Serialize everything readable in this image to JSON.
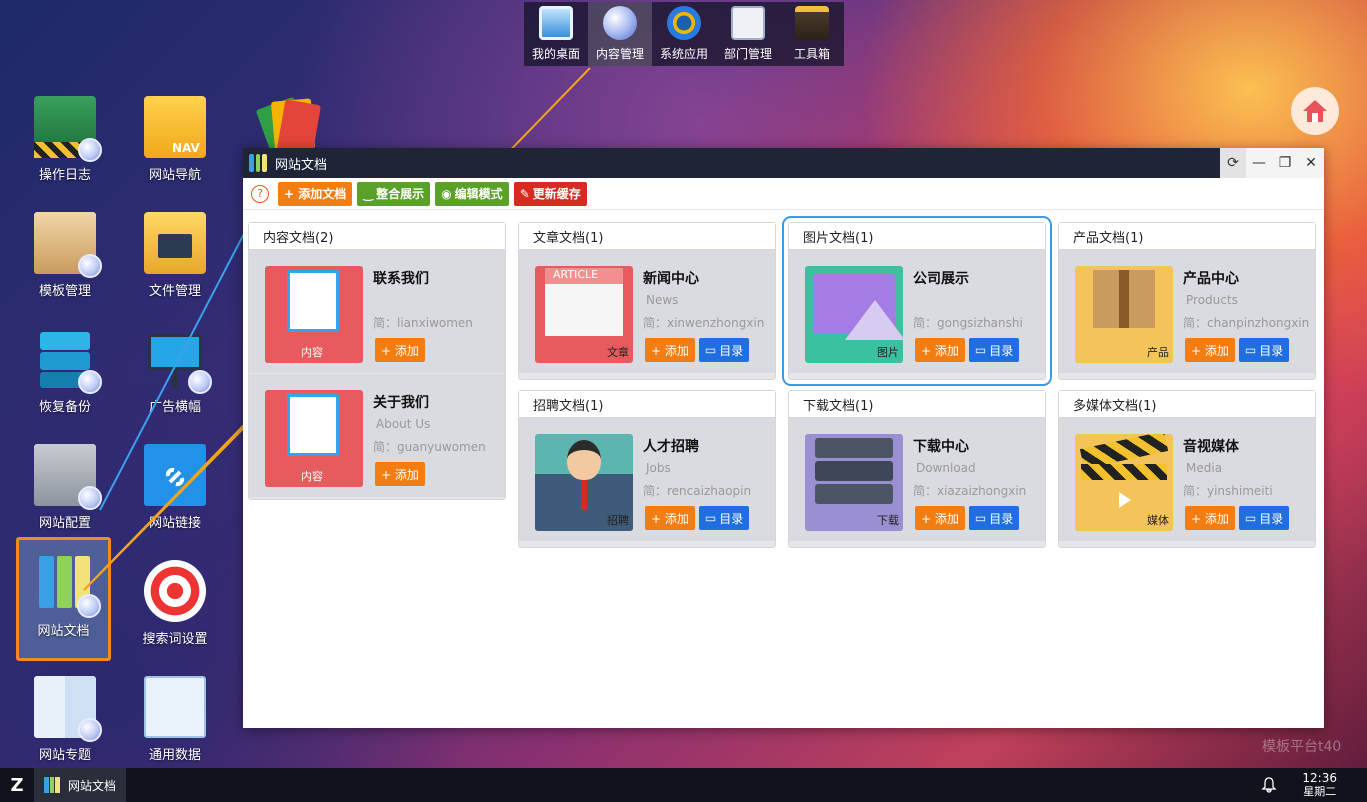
{
  "dock": {
    "items": [
      {
        "label": "我的桌面",
        "icon": "monitor-icon"
      },
      {
        "label": "内容管理",
        "icon": "globe-icon"
      },
      {
        "label": "系统应用",
        "icon": "gear-icon"
      },
      {
        "label": "部门管理",
        "icon": "id-card-icon"
      },
      {
        "label": "工具箱",
        "icon": "toolbox-icon"
      }
    ]
  },
  "desktop": {
    "icons": [
      {
        "label": "操作日志",
        "icon": "folder-log-icon"
      },
      {
        "label": "网站导航",
        "icon": "folder-nav-icon"
      },
      {
        "label": "",
        "icon": "cards-icon"
      },
      {
        "label": "模板管理",
        "icon": "archive-box-icon"
      },
      {
        "label": "文件管理",
        "icon": "folder-media-icon"
      },
      {
        "label": "恢复备份",
        "icon": "database-icon"
      },
      {
        "label": "广告横幅",
        "icon": "billboard-icon"
      },
      {
        "label": "网站配置",
        "icon": "server-icon"
      },
      {
        "label": "网站链接",
        "icon": "link-file-icon"
      },
      {
        "label": "网站文档",
        "icon": "binders-icon"
      },
      {
        "label": "搜索词设置",
        "icon": "target-icon"
      },
      {
        "label": "网站专题",
        "icon": "book-icon"
      },
      {
        "label": "通用数据",
        "icon": "document-icon"
      }
    ]
  },
  "window": {
    "title": "网站文档",
    "toolbar": {
      "help": "?",
      "add_doc": "+ 添加文档",
      "integrate": "整合展示",
      "edit_mode": "编辑模式",
      "refresh_cache": "更新缓存"
    },
    "panels": [
      {
        "header": "内容文档(2)",
        "entries": [
          {
            "title": "联系我们",
            "sub": "",
            "pinyin": "简：lianxiwomen",
            "tag": "内容",
            "add": "+ 添加",
            "dir": ""
          },
          {
            "title": "关于我们",
            "sub": "About Us",
            "pinyin": "简：guanyuwomen",
            "tag": "内容",
            "add": "+ 添加",
            "dir": ""
          }
        ]
      },
      {
        "header": "文章文档(1)",
        "entries": [
          {
            "title": "新闻中心",
            "sub": "News",
            "pinyin": "简：xinwenzhongxin",
            "tag": "文章",
            "art_label": "ARTICLE",
            "add": "+ 添加",
            "dir": "目录"
          }
        ]
      },
      {
        "header": "图片文档(1)",
        "entries": [
          {
            "title": "公司展示",
            "sub": "",
            "pinyin": "简：gongsizhanshi",
            "tag": "图片",
            "add": "+ 添加",
            "dir": "目录"
          }
        ]
      },
      {
        "header": "产品文档(1)",
        "entries": [
          {
            "title": "产品中心",
            "sub": "Products",
            "pinyin": "简：chanpinzhongxin",
            "tag": "产品",
            "add": "+ 添加",
            "dir": "目录"
          }
        ]
      },
      {
        "header": "招聘文档(1)",
        "entries": [
          {
            "title": "人才招聘",
            "sub": "Jobs",
            "pinyin": "简：rencaizhaopin",
            "tag": "招聘",
            "add": "+ 添加",
            "dir": "目录"
          }
        ]
      },
      {
        "header": "下载文档(1)",
        "entries": [
          {
            "title": "下载中心",
            "sub": "Download",
            "pinyin": "简：xiazaizhongxin",
            "tag": "下载",
            "add": "+ 添加",
            "dir": "目录"
          }
        ]
      },
      {
        "header": "多媒体文档(1)",
        "entries": [
          {
            "title": "音视媒体",
            "sub": "Media",
            "pinyin": "简：yinshimeiti",
            "tag": "媒体",
            "add": "+ 添加",
            "dir": "目录"
          }
        ]
      }
    ]
  },
  "taskbar": {
    "start": "Z",
    "task_label": "网站文档",
    "time": "12:36",
    "weekday": "星期二"
  },
  "watermark": "模板平台t40",
  "colors": {
    "orange": "#f27d13",
    "green": "#5aa12a",
    "red": "#d62b20",
    "blue": "#1f6fe0",
    "highlight": "#3a9ae6"
  }
}
